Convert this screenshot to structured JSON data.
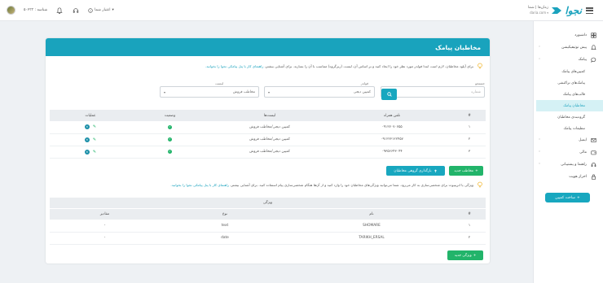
{
  "topbar": {
    "user_name": "زمان‌ها | شما",
    "site": "daria.com",
    "logo_text": "نجوا",
    "notify_label": "اعتبار شما",
    "ident_label": "شناسه : ۵۰۲۳۳"
  },
  "sidebar": {
    "items": [
      {
        "label": "داشبورد",
        "icon": "dashboard-icon"
      },
      {
        "label": "پیش نوتیفیکیشن",
        "icon": "bell-icon"
      },
      {
        "label": "پیامک",
        "icon": "sms-icon"
      }
    ],
    "sub_items": [
      {
        "label": "کمپین‌های پیامک",
        "active": false
      },
      {
        "label": "پیامک‌های تراکنشی",
        "active": false
      },
      {
        "label": "قالب‌های پیامک",
        "active": false
      },
      {
        "label": "مخاطبان پیامک",
        "active": true
      },
      {
        "label": "گروه‌بندی مخاطبان",
        "active": false
      },
      {
        "label": "تنظیمات پیامک",
        "active": false
      }
    ],
    "lower_items": [
      {
        "label": "ایمیل",
        "icon": "mail-icon"
      },
      {
        "label": "مالی",
        "icon": "wallet-icon"
      },
      {
        "label": "راهنما و پشتیبانی",
        "icon": "headset-icon"
      },
      {
        "label": "احراز هویت",
        "icon": "lock-icon"
      }
    ],
    "create_label": "ساخت کمپین"
  },
  "card": {
    "title": "مخاطبان پیامک",
    "info_text": "برای آپلود مخاطبان، لازم است ابتدا فولدر مورد نظر خود را ایجاد کنید و بر اساس آن، لیست (زیرگروه) متناسب با آن را بسازید. برای آشنایی بیشتر،",
    "info_link": "راهنمای کار با پنل پیامکی نجوا را بخوانید.",
    "filters": {
      "search_caption": "جستجو",
      "search_placeholder": "شماره",
      "folder_caption": "فولدر",
      "folder_value": "کمپین دیجی",
      "list_caption": "لیست",
      "list_value": "مخاطب فروش"
    },
    "contacts_table": {
      "headers": [
        "#",
        "تلفن همراه",
        "لیست‌ها",
        "وضعیت",
        "عملیات"
      ],
      "rows": [
        {
          "idx": "۱",
          "phone": "۰۹۱۲۷۰۷۰۷۵۵",
          "list": "کمپین دیجی/مخاطب فروش"
        },
        {
          "idx": "۲",
          "phone": "۰۹۱۲۲۳۱۲۲۴۵۷",
          "list": "کمپین دیجی/مخاطب فروش"
        },
        {
          "idx": "۳",
          "phone": "۰۹۳۵۶۶۴۳۰۴۴",
          "list": "کمپین دیجی/مخاطب فروش"
        }
      ]
    },
    "new_contact_label": "مخاطب جدید",
    "upload_group_label": "بارگذاری گروهی مخاطبان",
    "info2_text": "ویژگی یا اتریبیوت برای شخصی‌سازی به کار می‌رود. شما می‌توانید ویژگی‌های مخاطبان خود را وارد کنید و از آن‌ها هنگام شخصی‌سازی پیام استفاده کنید. برای آشنایی بیشتر،",
    "info2_link": "راهنمای کار با پنل پیامکی نجوا را بخوانید.",
    "attributes_table": {
      "group_header": "ویژگی",
      "headers": [
        "#",
        "نام",
        "نوع",
        "مقادیر"
      ],
      "rows": [
        {
          "idx": "۱",
          "name": "SHOMARE",
          "type": "text",
          "values": "-"
        },
        {
          "idx": "۲",
          "name": "TARIKH_ERSAL",
          "type": "date",
          "values": "-"
        }
      ]
    },
    "new_attribute_label": "ویژگی جدید"
  },
  "colors": {
    "accent": "#19a3bd",
    "success": "#22b46a"
  }
}
